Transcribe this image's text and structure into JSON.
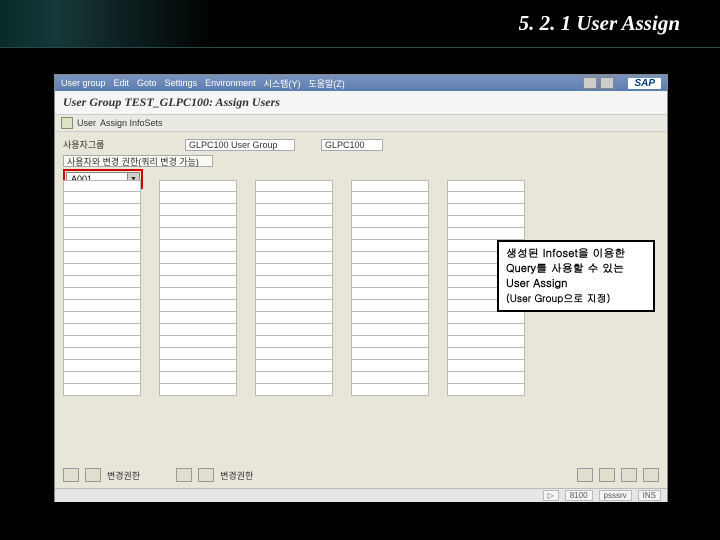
{
  "slide": {
    "title": "5. 2. 1 User Assign"
  },
  "menu": {
    "items": [
      "User group",
      "Edit",
      "Goto",
      "Settings",
      "Environment",
      "시스템(Y)",
      "도움말(Z)"
    ],
    "logo": "SAP"
  },
  "window": {
    "title": "User Group TEST_GLPC100: Assign Users"
  },
  "toolbar": {
    "items": [
      "User",
      "Assign InfoSets"
    ]
  },
  "field_row": {
    "label": "사용자그룹",
    "val1_label": "",
    "val1": "GLPC100 User Group",
    "val2_label": "",
    "val2": "GLPC100"
  },
  "header_row": {
    "text": "사용자와 변경 권한(쿼리 변경 가능)"
  },
  "dropdown": {
    "value": "A001"
  },
  "bottom": {
    "label1": "변경권한",
    "label2": "변경권한"
  },
  "status": {
    "items": [
      "▷",
      "8100",
      "psssrv",
      "INS"
    ]
  },
  "callout": {
    "line1": "생성된 Infoset을 이용한",
    "line2": "Query를 사용할 수 있는",
    "line3": "User Assign",
    "line4": "(User Group으로 지정)"
  },
  "columns": {
    "count": 5,
    "rows": 18
  }
}
